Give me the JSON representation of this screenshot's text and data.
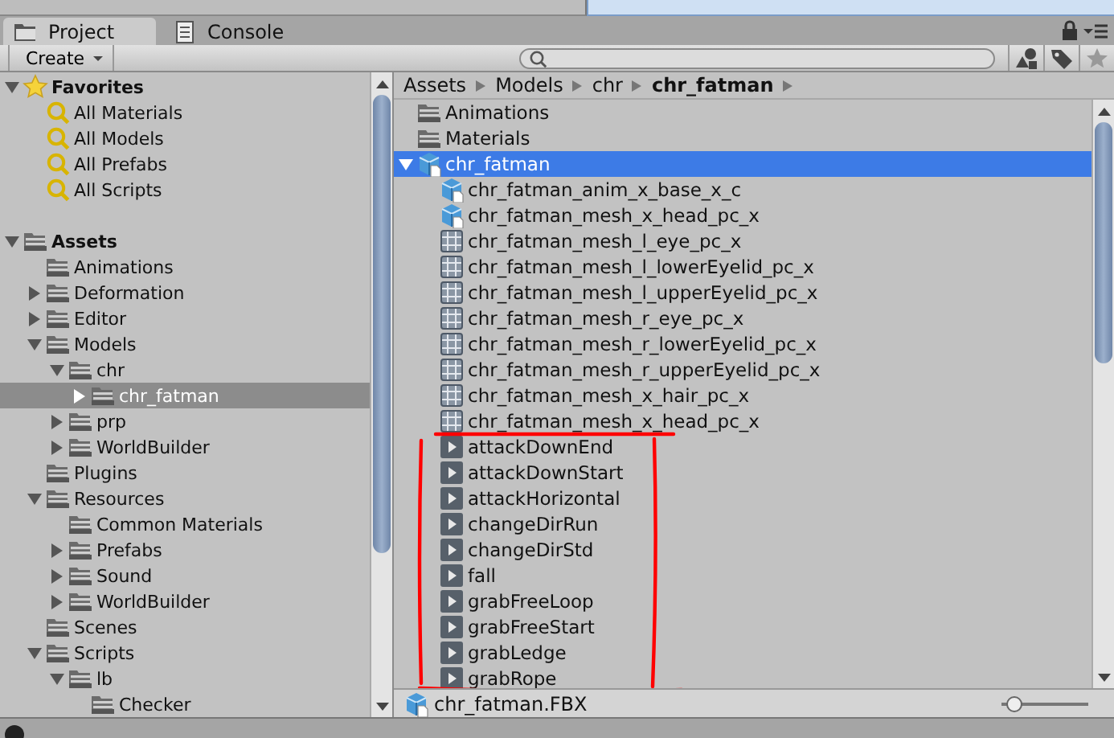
{
  "tabs": [
    {
      "label": "Project",
      "kind": "project",
      "selected": true
    },
    {
      "label": "Console",
      "kind": "console",
      "selected": false
    }
  ],
  "toolbar": {
    "create_button": "Create"
  },
  "left_tree": {
    "items": [
      {
        "label": "Favorites",
        "kind": "star",
        "bold": true,
        "expanded": true,
        "children": [
          {
            "label": "All Materials",
            "kind": "search"
          },
          {
            "label": "All Models",
            "kind": "search"
          },
          {
            "label": "All Prefabs",
            "kind": "search"
          },
          {
            "label": "All Scripts",
            "kind": "search"
          }
        ]
      },
      {
        "kind": "spacer"
      },
      {
        "label": "Assets",
        "kind": "folder",
        "bold": true,
        "expanded": true,
        "children": [
          {
            "label": "Animations",
            "kind": "folder"
          },
          {
            "label": "Deformation",
            "kind": "folder",
            "expanded": false
          },
          {
            "label": "Editor",
            "kind": "folder",
            "expanded": false
          },
          {
            "label": "Models",
            "kind": "folder",
            "expanded": true,
            "children": [
              {
                "label": "chr",
                "kind": "folder",
                "expanded": true,
                "children": [
                  {
                    "label": "chr_fatman",
                    "kind": "folder",
                    "expanded": false,
                    "selected": true
                  }
                ]
              },
              {
                "label": "prp",
                "kind": "folder",
                "expanded": false
              },
              {
                "label": "WorldBuilder",
                "kind": "folder",
                "expanded": false
              }
            ]
          },
          {
            "label": "Plugins",
            "kind": "folder"
          },
          {
            "label": "Resources",
            "kind": "folder",
            "expanded": true,
            "children": [
              {
                "label": "Common Materials",
                "kind": "folder"
              },
              {
                "label": "Prefabs",
                "kind": "folder",
                "expanded": false
              },
              {
                "label": "Sound",
                "kind": "folder",
                "expanded": false
              },
              {
                "label": "WorldBuilder",
                "kind": "folder",
                "expanded": false
              }
            ]
          },
          {
            "label": "Scenes",
            "kind": "folder"
          },
          {
            "label": "Scripts",
            "kind": "folder",
            "expanded": true,
            "children": [
              {
                "label": "lb",
                "kind": "folder",
                "expanded": true,
                "children": [
                  {
                    "label": "Checker",
                    "kind": "folder"
                  }
                ]
              }
            ]
          }
        ]
      }
    ]
  },
  "breadcrumb": [
    {
      "label": "Assets",
      "current": false
    },
    {
      "label": "Models",
      "current": false
    },
    {
      "label": "chr",
      "current": false
    },
    {
      "label": "chr_fatman",
      "current": true
    }
  ],
  "asset_list": {
    "items": [
      {
        "label": "Animations",
        "kind": "folder",
        "selected": false
      },
      {
        "label": "Materials",
        "kind": "folder",
        "selected": false
      },
      {
        "label": "chr_fatman",
        "kind": "model",
        "selected": true,
        "expanded": true,
        "children": [
          {
            "label": "chr_fatman_anim_x_base_x_c",
            "kind": "model",
            "selected": false
          },
          {
            "label": "chr_fatman_mesh_x_head_pc_x",
            "kind": "model",
            "selected": false
          },
          {
            "label": "chr_fatman_mesh_l_eye_pc_x",
            "kind": "mesh",
            "selected": false
          },
          {
            "label": "chr_fatman_mesh_l_lowerEyelid_pc_x",
            "kind": "mesh",
            "selected": false
          },
          {
            "label": "chr_fatman_mesh_l_upperEyelid_pc_x",
            "kind": "mesh",
            "selected": false
          },
          {
            "label": "chr_fatman_mesh_r_eye_pc_x",
            "kind": "mesh",
            "selected": false
          },
          {
            "label": "chr_fatman_mesh_r_lowerEyelid_pc_x",
            "kind": "mesh",
            "selected": false
          },
          {
            "label": "chr_fatman_mesh_r_upperEyelid_pc_x",
            "kind": "mesh",
            "selected": false
          },
          {
            "label": "chr_fatman_mesh_x_hair_pc_x",
            "kind": "mesh",
            "selected": false
          },
          {
            "label": "chr_fatman_mesh_x_head_pc_x",
            "kind": "mesh",
            "selected": false
          },
          {
            "label": "attackDownEnd",
            "kind": "clip",
            "selected": false
          },
          {
            "label": "attackDownStart",
            "kind": "clip",
            "selected": false
          },
          {
            "label": "attackHorizontal",
            "kind": "clip",
            "selected": false
          },
          {
            "label": "changeDirRun",
            "kind": "clip",
            "selected": false
          },
          {
            "label": "changeDirStd",
            "kind": "clip",
            "selected": false
          },
          {
            "label": "fall",
            "kind": "clip",
            "selected": false
          },
          {
            "label": "grabFreeLoop",
            "kind": "clip",
            "selected": false
          },
          {
            "label": "grabFreeStart",
            "kind": "clip",
            "selected": false
          },
          {
            "label": "grabLedge",
            "kind": "clip",
            "selected": false
          },
          {
            "label": "grabRope",
            "kind": "clip",
            "selected": false
          }
        ]
      }
    ]
  },
  "highlight_outline": true,
  "footer": {
    "file": "chr_fatman.FBX",
    "kind": "model",
    "zoom": {
      "level": 0.05
    }
  }
}
